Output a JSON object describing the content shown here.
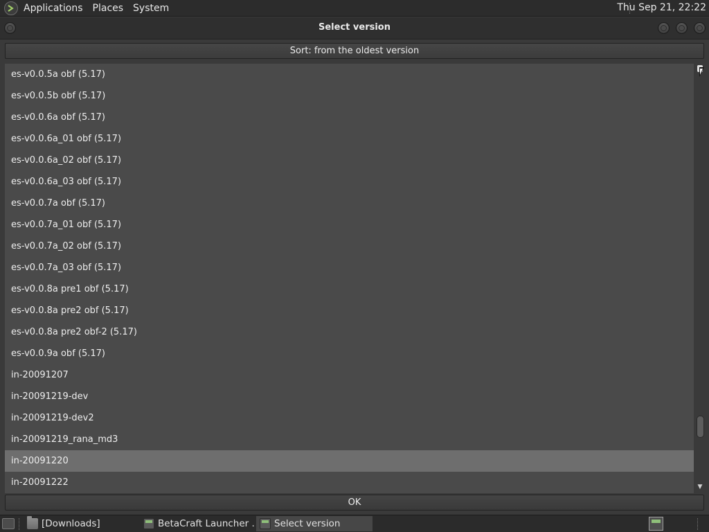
{
  "top_panel": {
    "logo_icon": "terminal-prompt-icon",
    "menus": [
      "Applications",
      "Places",
      "System"
    ],
    "clock": "Thu Sep 21, 22:22"
  },
  "window": {
    "title": "Select version",
    "sort_label": "Sort: from the oldest version",
    "ok_label": "OK",
    "versions": [
      "es-v0.0.5a obf (5.17)",
      "es-v0.0.5b obf (5.17)",
      "es-v0.0.6a obf (5.17)",
      "es-v0.0.6a_01 obf (5.17)",
      "es-v0.0.6a_02 obf (5.17)",
      "es-v0.0.6a_03 obf (5.17)",
      "es-v0.0.7a obf (5.17)",
      "es-v0.0.7a_01 obf (5.17)",
      "es-v0.0.7a_02 obf (5.17)",
      "es-v0.0.7a_03 obf (5.17)",
      "es-v0.0.8a pre1 obf (5.17)",
      "es-v0.0.8a pre2 obf (5.17)",
      "es-v0.0.8a pre2 obf-2 (5.17)",
      "es-v0.0.9a obf (5.17)",
      "in-20091207",
      "in-20091219-dev",
      "in-20091219-dev2",
      "in-20091219_rana_md3",
      "in-20091220",
      "in-20091222"
    ],
    "selected_version": "in-20091220"
  },
  "taskbar": {
    "tasks": [
      {
        "label": "[Downloads]",
        "icon": "folder-icon"
      },
      {
        "label": "BetaCraft Launcher ...",
        "icon": "betacraft-icon"
      },
      {
        "label": "Select version",
        "icon": "betacraft-icon"
      }
    ],
    "active_task": "Select version",
    "tray_icon": "betacraft-icon"
  },
  "colors": {
    "panel": "#2c2c2c",
    "list_background": "#4a4a4a",
    "selected_row": "#6e6e6e",
    "text": "#eeeeee"
  }
}
